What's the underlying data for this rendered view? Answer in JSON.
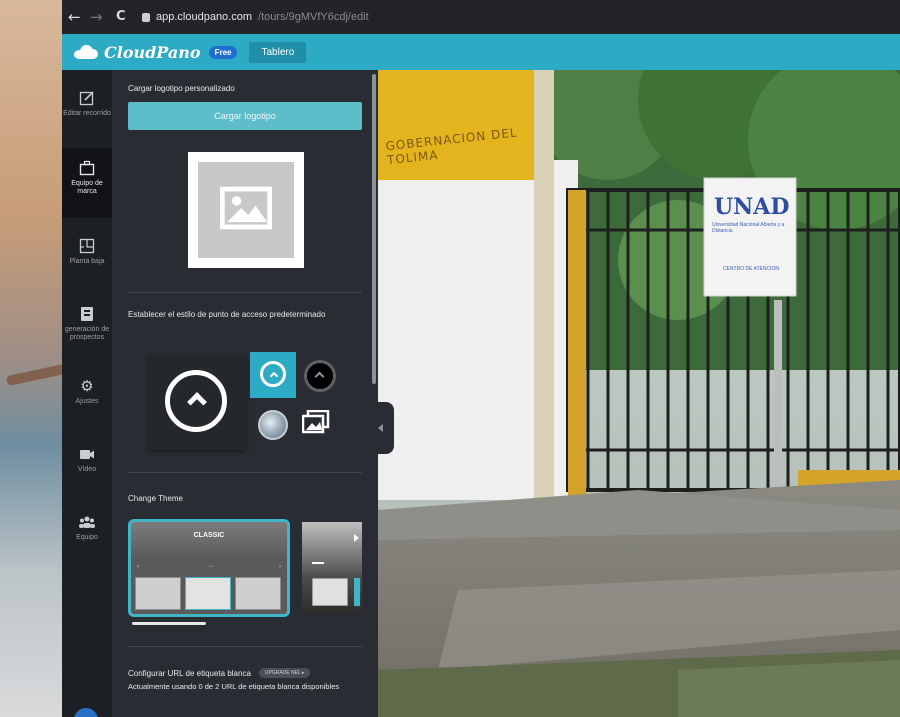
{
  "browser": {
    "back": "←",
    "forward": "→",
    "reload": "C",
    "url_host": "app.cloudpano.com",
    "url_path": "/tours/9gMVfY6cdj/edit"
  },
  "header": {
    "logo_text": "CloudPano",
    "plan_badge": "Free",
    "dashboard_button": "Tablero"
  },
  "rail": {
    "items": [
      {
        "label": "Editar recorrido",
        "icon": "edit-icon"
      },
      {
        "label": "Equipo de marca",
        "icon": "briefcase-icon"
      },
      {
        "label": "Planta baja",
        "icon": "floorplan-icon"
      },
      {
        "label": "generación de prospectos",
        "icon": "contact-card-icon"
      },
      {
        "label": "Ajustes",
        "icon": "gear-icon"
      },
      {
        "label": "Vídeo",
        "icon": "video-icon"
      },
      {
        "label": "Equipo",
        "icon": "team-icon"
      }
    ],
    "active_index": 1
  },
  "panel": {
    "upload_title": "Cargar logotipo personalizado",
    "upload_button": "Cargar logotipo",
    "hotspot_title": "Establecer el estilo de punto de acceso predeterminado",
    "theme_title": "Change Theme",
    "theme_selected": "CLASSIC",
    "whitelabel_title": "Configurar URL de etiqueta blanca",
    "whitelabel_badge": "UPGRADE NEL ▸",
    "whitelabel_desc": "Actualmente usando 0 de 2 URL de etiqueta blanca disponibles"
  },
  "scene": {
    "sign_left": "GOBERNACION DEL TOLIMA",
    "sign_logo": "UNAD",
    "sign_sub": "Universidad Nacional Abierta y a Distancia",
    "sign_small": "CENTRO DE ATENCION"
  },
  "colors": {
    "accent": "#2eabc4",
    "panel_bg": "#292d33",
    "rail_bg": "#1c1f24"
  }
}
